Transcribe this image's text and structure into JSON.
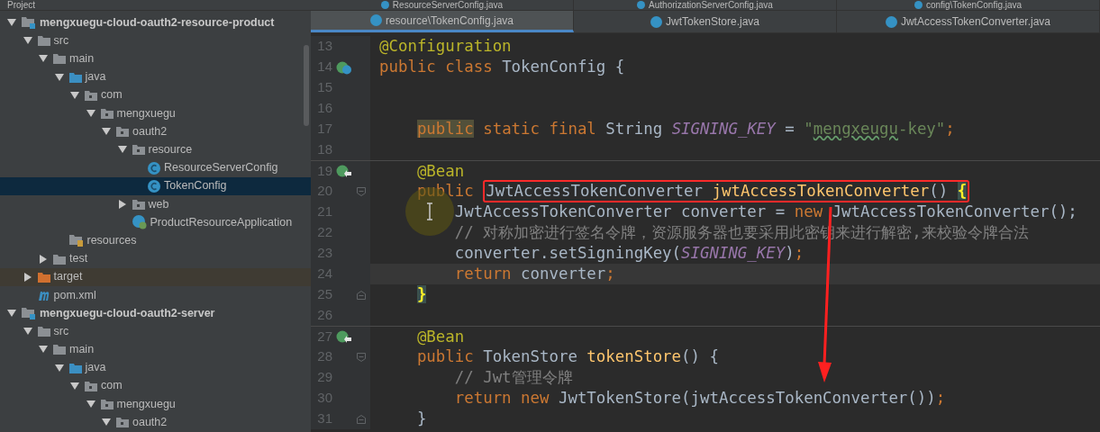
{
  "project_panel": {
    "title": "Project",
    "tree": [
      {
        "label": "mengxuegu-cloud-oauth2-resource-product",
        "kind": "module",
        "expanded": true,
        "selected": false,
        "children": [
          {
            "label": "src",
            "kind": "folder",
            "expanded": true,
            "selected": false,
            "children": [
              {
                "label": "main",
                "kind": "folder",
                "expanded": true,
                "selected": false,
                "children": [
                  {
                    "label": "java",
                    "kind": "source_folder",
                    "expanded": true,
                    "selected": false,
                    "children": [
                      {
                        "label": "com",
                        "kind": "package",
                        "expanded": true,
                        "selected": false,
                        "children": [
                          {
                            "label": "mengxuegu",
                            "kind": "package",
                            "expanded": true,
                            "selected": false,
                            "children": [
                              {
                                "label": "oauth2",
                                "kind": "package",
                                "expanded": true,
                                "selected": false,
                                "children": [
                                  {
                                    "label": "resource",
                                    "kind": "package",
                                    "expanded": true,
                                    "selected": false,
                                    "children": [
                                      {
                                        "label": "ResourceServerConfig",
                                        "kind": "class",
                                        "selected": false
                                      },
                                      {
                                        "label": "TokenConfig",
                                        "kind": "class",
                                        "selected": true
                                      }
                                    ]
                                  },
                                  {
                                    "label": "web",
                                    "kind": "package",
                                    "expanded": false,
                                    "selected": false
                                  },
                                  {
                                    "label": "ProductResourceApplication",
                                    "kind": "spring_app",
                                    "selected": false
                                  }
                                ]
                              }
                            ]
                          }
                        ]
                      }
                    ]
                  },
                  {
                    "label": "resources",
                    "kind": "resources_folder",
                    "selected": false
                  }
                ]
              },
              {
                "label": "test",
                "kind": "folder",
                "expanded": false,
                "selected": false
              }
            ]
          },
          {
            "label": "target",
            "kind": "excluded_folder",
            "expanded": false,
            "selected": false
          },
          {
            "label": "pom.xml",
            "kind": "maven",
            "selected": false
          }
        ]
      },
      {
        "label": "mengxuegu-cloud-oauth2-server",
        "kind": "module",
        "expanded": true,
        "selected": false,
        "children": [
          {
            "label": "src",
            "kind": "folder",
            "expanded": true,
            "selected": false,
            "children": [
              {
                "label": "main",
                "kind": "folder",
                "expanded": true,
                "selected": false,
                "children": [
                  {
                    "label": "java",
                    "kind": "source_folder",
                    "expanded": true,
                    "selected": false,
                    "children": [
                      {
                        "label": "com",
                        "kind": "package",
                        "expanded": true,
                        "selected": false,
                        "children": [
                          {
                            "label": "mengxuegu",
                            "kind": "package",
                            "expanded": true,
                            "selected": false,
                            "children": [
                              {
                                "label": "oauth2",
                                "kind": "package",
                                "expanded": true,
                                "selected": false
                              }
                            ]
                          }
                        ]
                      }
                    ]
                  }
                ]
              }
            ]
          }
        ]
      }
    ]
  },
  "tab_rows": [
    [
      {
        "label": "ResourceServerConfig.java",
        "selected": false
      },
      {
        "label": "AuthorizationServerConfig.java",
        "selected": false
      },
      {
        "label": "config\\TokenConfig.java",
        "selected": false
      }
    ],
    [
      {
        "label": "resource\\TokenConfig.java",
        "selected": true
      },
      {
        "label": "JwtTokenStore.java",
        "selected": false
      },
      {
        "label": "JwtAccessTokenConverter.java",
        "selected": false
      }
    ]
  ],
  "editor": {
    "lines": [
      {
        "number": "13",
        "tokens": [
          {
            "kind": "annotation",
            "text": "@Configuration"
          }
        ]
      },
      {
        "number": "14",
        "gutter": {
          "kind": "bean_class"
        },
        "tokens": [
          {
            "kind": "keyword",
            "text": "public class "
          },
          {
            "kind": "plain",
            "text": "TokenConfig {"
          }
        ]
      },
      {
        "number": "15"
      },
      {
        "number": "16"
      },
      {
        "number": "17",
        "tokens": [
          {
            "kind": "keyword_warn",
            "text": "    public"
          },
          {
            "kind": "keyword",
            "text": " static final "
          },
          {
            "kind": "plain",
            "text": "String "
          },
          {
            "kind": "constant",
            "text": "SIGNING_KEY"
          },
          {
            "kind": "plain",
            "text": " = "
          },
          {
            "kind": "string",
            "text": "\""
          },
          {
            "kind": "string_typo",
            "text": "mengxeugu"
          },
          {
            "kind": "string",
            "text": "-key\""
          },
          {
            "kind": "keyword",
            "text": ";"
          }
        ]
      },
      {
        "number": "18"
      },
      {
        "number": "19",
        "separator": true,
        "gutter": {
          "kind": "bean_method"
        },
        "tokens": [
          {
            "kind": "annotation",
            "text": "    @Bean"
          }
        ]
      },
      {
        "number": "20",
        "fold": {
          "kind": "start"
        },
        "tokens": [
          {
            "kind": "keyword",
            "text": "    public "
          },
          {
            "kind": "plain",
            "text": "JwtAccessTokenConverter ",
            "boxed": true
          },
          {
            "kind": "method",
            "text": "jwtAccessTokenConverter",
            "boxed": true
          },
          {
            "kind": "plain",
            "text": "() ",
            "boxed": true
          },
          {
            "kind": "brace_match",
            "text": "{",
            "boxed": true
          }
        ]
      },
      {
        "number": "21",
        "tokens": [
          {
            "kind": "plain",
            "text": "        JwtAccessTokenConverter converter = "
          },
          {
            "kind": "keyword",
            "text": "new "
          },
          {
            "kind": "plain",
            "text": "JwtAccessTokenConverter();"
          }
        ]
      },
      {
        "number": "22",
        "tokens": [
          {
            "kind": "comment",
            "text": "        // 对称加密进行签名令牌，资源服务器也要采用此密钥来进行解密,来校验令牌合法"
          }
        ]
      },
      {
        "number": "23",
        "tokens": [
          {
            "kind": "plain",
            "text": "        converter.setSigningKey("
          },
          {
            "kind": "constant",
            "text": "SIGNING_KEY"
          },
          {
            "kind": "plain",
            "text": ")"
          },
          {
            "kind": "keyword",
            "text": ";"
          }
        ]
      },
      {
        "number": "24",
        "current": true,
        "tokens": [
          {
            "kind": "keyword",
            "text": "        return "
          },
          {
            "kind": "plain",
            "text": "converter"
          },
          {
            "kind": "keyword",
            "text": ";"
          }
        ]
      },
      {
        "number": "25",
        "fold": {
          "kind": "end"
        },
        "tokens": [
          {
            "kind": "brace_match",
            "text": "    }"
          }
        ]
      },
      {
        "number": "26"
      },
      {
        "number": "27",
        "separator": true,
        "gutter": {
          "kind": "bean_method"
        },
        "tokens": [
          {
            "kind": "annotation",
            "text": "    @Bean"
          }
        ]
      },
      {
        "number": "28",
        "fold": {
          "kind": "start"
        },
        "tokens": [
          {
            "kind": "keyword",
            "text": "    public "
          },
          {
            "kind": "plain",
            "text": "TokenStore "
          },
          {
            "kind": "method",
            "text": "tokenStore"
          },
          {
            "kind": "plain",
            "text": "() {"
          }
        ]
      },
      {
        "number": "29",
        "tokens": [
          {
            "kind": "comment",
            "text": "        // Jwt管理令牌"
          }
        ]
      },
      {
        "number": "30",
        "tokens": [
          {
            "kind": "keyword",
            "text": "        return new "
          },
          {
            "kind": "plain",
            "text": "JwtTokenStore(jwtAccessTokenConverter())"
          },
          {
            "kind": "keyword",
            "text": ";"
          }
        ]
      },
      {
        "number": "31",
        "fold": {
          "kind": "end"
        },
        "tokens": [
          {
            "kind": "plain",
            "text": "    }"
          }
        ]
      }
    ]
  }
}
